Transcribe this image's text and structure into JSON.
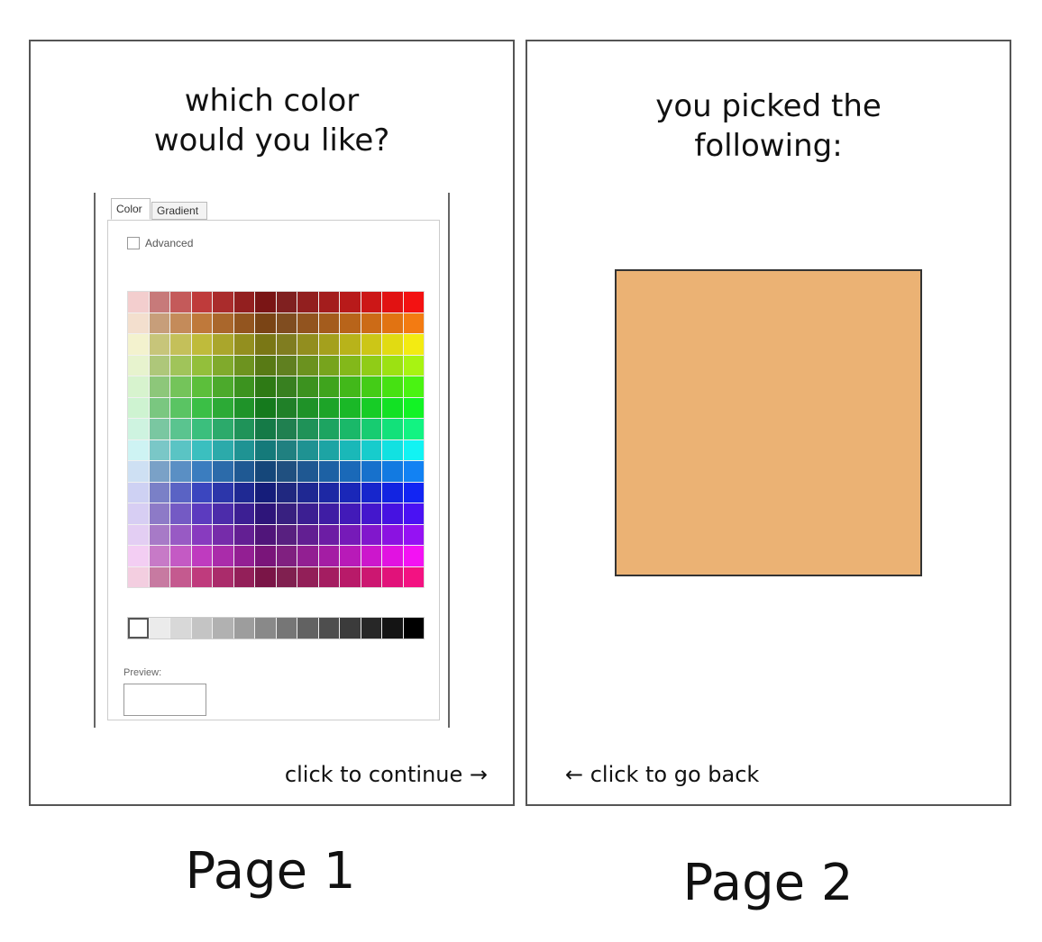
{
  "page1": {
    "heading_line1": "which color",
    "heading_line2": "would you like?",
    "continue_link": "click to continue →",
    "caption": "Page 1",
    "picker": {
      "tabs": [
        "Color",
        "Gradient"
      ],
      "advanced_label": "Advanced",
      "preview_label": "Preview:"
    }
  },
  "page2": {
    "heading_line1": "you picked the",
    "heading_line2": "following:",
    "back_link": "← click to go back",
    "caption": "Page 2",
    "selected_color": "#EBB274"
  },
  "colors": {
    "frame_border": "#555555"
  }
}
